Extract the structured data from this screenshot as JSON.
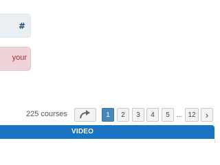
{
  "info_box": {
    "text": "#"
  },
  "alert_box": {
    "text": "your"
  },
  "pagination": {
    "count_text": "225 courses",
    "pages": [
      "1",
      "2",
      "3",
      "4",
      "5"
    ],
    "ellipsis": "...",
    "last_page": "12",
    "active_page": "1",
    "next_symbol": "›"
  },
  "table": {
    "column_header": "VIDEO"
  },
  "colors": {
    "accent": "#1a74c2",
    "active_page": "#4a87b8",
    "alert_text": "#a52a3a",
    "info_text": "#1f4e79"
  }
}
